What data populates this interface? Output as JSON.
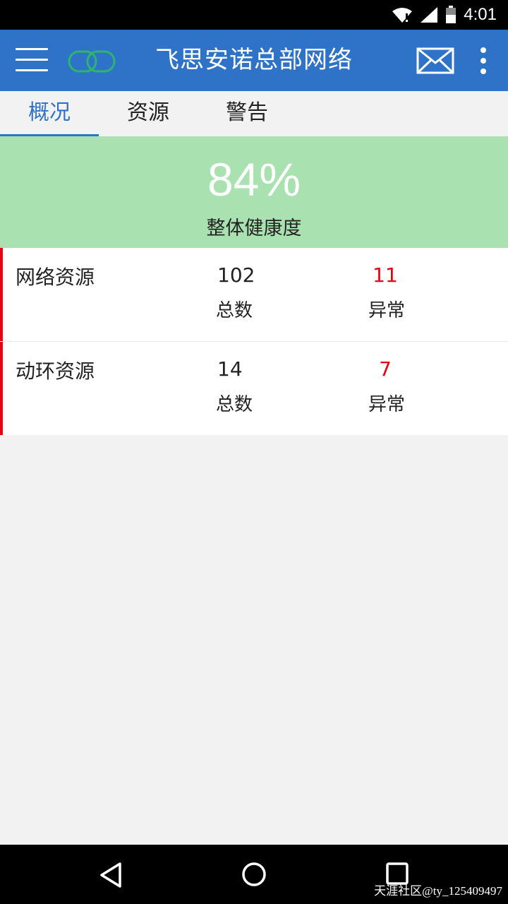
{
  "status_bar": {
    "time": "4:01",
    "icons": [
      "wifi-icon",
      "signal-icon",
      "battery-icon"
    ]
  },
  "app_bar": {
    "title": "飞思安诺总部网络",
    "icons": [
      "menu-icon",
      "logo-icon",
      "mail-icon",
      "more-vert-icon"
    ]
  },
  "tabs": [
    {
      "label": "概况",
      "active": true
    },
    {
      "label": "资源",
      "active": false
    },
    {
      "label": "警告",
      "active": false
    }
  ],
  "health": {
    "value": "84%",
    "label": "整体健康度"
  },
  "resources": [
    {
      "name": "网络资源",
      "total": "102",
      "total_label": "总数",
      "abnormal": "11",
      "abnormal_label": "异常"
    },
    {
      "name": "动环资源",
      "total": "14",
      "total_label": "总数",
      "abnormal": "7",
      "abnormal_label": "异常"
    }
  ],
  "nav_bar": {
    "icons": [
      "back-icon",
      "home-icon",
      "recents-icon"
    ]
  },
  "watermark": "天涯社区@ty_125409497",
  "colors": {
    "primary": "#2f73c9",
    "health_bg": "#a9e2b0",
    "alert": "#e60012",
    "logo": "#2db56d"
  }
}
